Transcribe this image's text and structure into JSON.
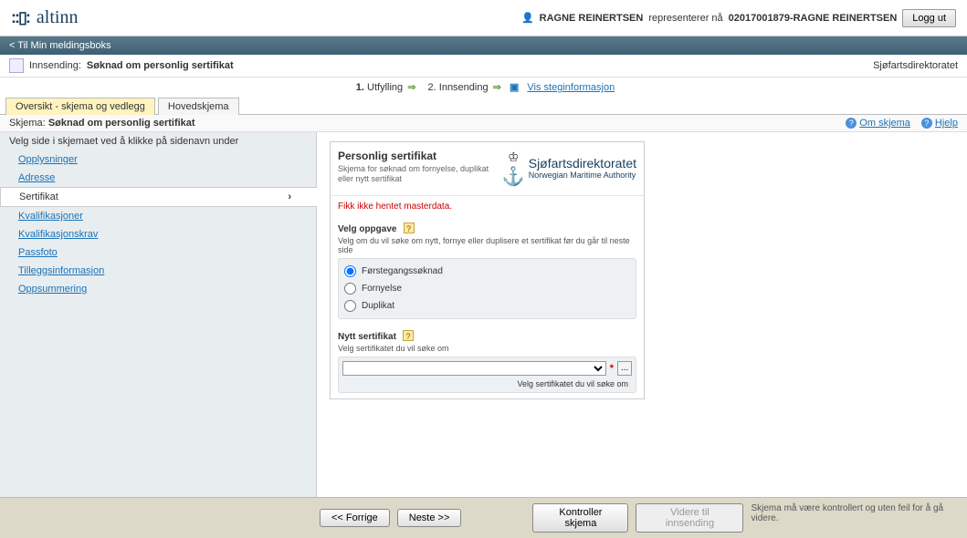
{
  "header": {
    "logo": "altinn",
    "user_icon": "person-icon",
    "user_name": "RAGNE REINERTSEN",
    "represents_text": "representerer nå",
    "represents_id": "02017001879-RAGNE REINERTSEN",
    "logout": "Logg ut"
  },
  "navbar": {
    "back_link": "< Til Min meldingsboks"
  },
  "submission": {
    "label": "Innsending:",
    "title": "Søknad om personlig sertifikat",
    "owner": "Sjøfartsdirektoratet"
  },
  "steps": {
    "s1_num": "1.",
    "s1_label": "Utfylling",
    "s2_num": "2.",
    "s2_label": "Innsending",
    "show_info": "Vis steginformasjon"
  },
  "tabs": {
    "t1": "Oversikt - skjema og vedlegg",
    "t2": "Hovedskjema"
  },
  "schema": {
    "prefix": "Skjema:",
    "name": "Søknad om personlig sertifikat",
    "about": "Om skjema",
    "help": "Hjelp"
  },
  "sidebar": {
    "header": "Velg side i skjemaet ved å klikke på sidenavn under",
    "items": [
      "Opplysninger",
      "Adresse",
      "Sertifikat",
      "Kvalifikasjoner",
      "Kvalifikasjonskrav",
      "Passfoto",
      "Tilleggsinformasjon",
      "Oppsummering"
    ]
  },
  "form": {
    "title": "Personlig sertifikat",
    "subtitle": "Skjema for søknad om fornyelse, duplikat eller nytt sertifikat",
    "authority_name": "Sjøfartsdirektoratet",
    "authority_sub": "Norwegian Maritime Authority",
    "error": "Fikk ikke hentet masterdata.",
    "task_label": "Velg oppgave",
    "task_desc": "Velg om du vil søke om nytt, fornye eller duplisere et sertifikat før du går til neste side",
    "radios": {
      "r1": "Førstegangssøknad",
      "r2": "Fornyelse",
      "r3": "Duplikat"
    },
    "newcert_label": "Nytt sertifikat",
    "newcert_desc": "Velg sertifikatet du vil søke om",
    "list_btn": "...",
    "select_hint": "Velg sertifikatet du vil søke om"
  },
  "footer": {
    "prev": "<< Forrige",
    "next": "Neste >>",
    "check": "Kontroller skjema",
    "continue": "Videre til innsending",
    "msg": "Skjema må være kontrollert og uten feil for å gå videre."
  }
}
